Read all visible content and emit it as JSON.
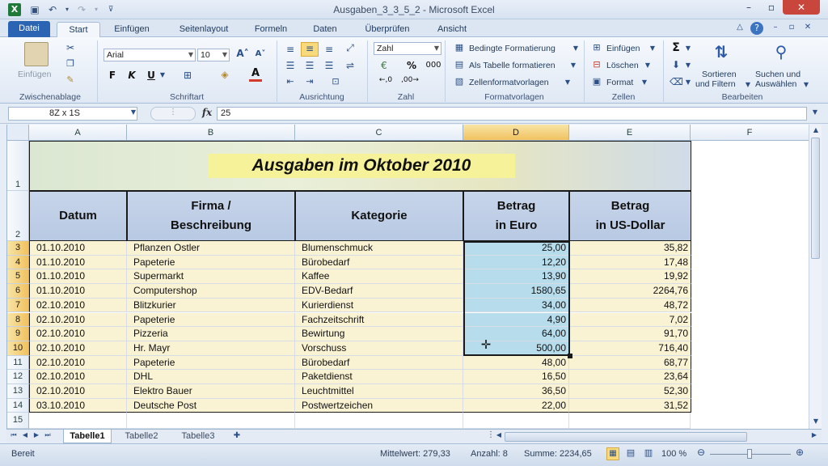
{
  "window": {
    "title": "Ausgaben_3_3_5_2 - Microsoft Excel",
    "app_icon": "X",
    "controls": {
      "minimize": "–",
      "maximize": "▫",
      "close": "✕"
    }
  },
  "tabs": [
    {
      "label": "Datei"
    },
    {
      "label": "Start"
    },
    {
      "label": "Einfügen"
    },
    {
      "label": "Seitenlayout"
    },
    {
      "label": "Formeln"
    },
    {
      "label": "Daten"
    },
    {
      "label": "Überprüfen"
    },
    {
      "label": "Ansicht"
    }
  ],
  "ribbon": {
    "clipboard": {
      "paste": "Einfügen",
      "group": "Zwischenablage"
    },
    "font": {
      "name": "Arial",
      "size": "10",
      "bold": "F",
      "italic": "K",
      "underline": "U",
      "group": "Schriftart"
    },
    "alignment": {
      "group": "Ausrichtung"
    },
    "number": {
      "format": "Zahl",
      "percent": "%",
      "thousands": "000",
      "group": "Zahl"
    },
    "styles": {
      "conditional": "Bedingte Formatierung",
      "as_table": "Als Tabelle formatieren",
      "cell_styles": "Zellenformatvorlagen",
      "group": "Formatvorlagen"
    },
    "cells": {
      "insert": "Einfügen",
      "delete": "Löschen",
      "format": "Format",
      "group": "Zellen"
    },
    "editing": {
      "sum": "Σ",
      "sort_line1": "Sortieren",
      "sort_line2": "und Filtern",
      "find_line1": "Suchen und",
      "find_line2": "Auswählen",
      "group": "Bearbeiten"
    }
  },
  "formula_bar": {
    "name_box": "8Z x 1S",
    "fx": "fx",
    "value": "25"
  },
  "columns": [
    "A",
    "B",
    "C",
    "D",
    "E",
    "F"
  ],
  "rows": [
    "1",
    "2",
    "3",
    "4",
    "5",
    "6",
    "7",
    "8",
    "9",
    "10",
    "11",
    "12",
    "13",
    "14",
    "15"
  ],
  "sheet": {
    "title": "Ausgaben im Oktober 2010",
    "headers": {
      "datum": "Datum",
      "firma_l1": "Firma /",
      "firma_l2": "Beschreibung",
      "kategorie": "Kategorie",
      "eur_l1": "Betrag",
      "eur_l2": "in Euro",
      "usd_l1": "Betrag",
      "usd_l2": "in US-Dollar"
    },
    "data": [
      [
        "01.10.2010",
        "Pflanzen Ostler",
        "Blumenschmuck",
        "25,00",
        "35,82"
      ],
      [
        "01.10.2010",
        "Papeterie",
        "Bürobedarf",
        "12,20",
        "17,48"
      ],
      [
        "01.10.2010",
        "Supermarkt",
        "Kaffee",
        "13,90",
        "19,92"
      ],
      [
        "01.10.2010",
        "Computershop",
        "EDV-Bedarf",
        "1580,65",
        "2264,76"
      ],
      [
        "02.10.2010",
        "Blitzkurier",
        "Kurierdienst",
        "34,00",
        "48,72"
      ],
      [
        "02.10.2010",
        "Papeterie",
        "Fachzeitschrift",
        "4,90",
        "7,02"
      ],
      [
        "02.10.2010",
        "Pizzeria",
        "Bewirtung",
        "64,00",
        "91,70"
      ],
      [
        "02.10.2010",
        "Hr. Mayr",
        "Vorschuss",
        "500,00",
        "716,40"
      ],
      [
        "02.10.2010",
        "Papeterie",
        "Bürobedarf",
        "48,00",
        "68,77"
      ],
      [
        "02.10.2010",
        "DHL",
        "Paketdienst",
        "16,50",
        "23,64"
      ],
      [
        "02.10.2010",
        "Elektro Bauer",
        "Leuchtmittel",
        "36,50",
        "52,30"
      ],
      [
        "03.10.2010",
        "Deutsche Post",
        "Postwertzeichen",
        "22,00",
        "31,52"
      ]
    ]
  },
  "sheet_tabs": [
    "Tabelle1",
    "Tabelle2",
    "Tabelle3"
  ],
  "status": {
    "mode": "Bereit",
    "average": "Mittelwert: 279,33",
    "count": "Anzahl: 8",
    "sum": "Summe: 2234,65",
    "zoom": "100 %"
  }
}
